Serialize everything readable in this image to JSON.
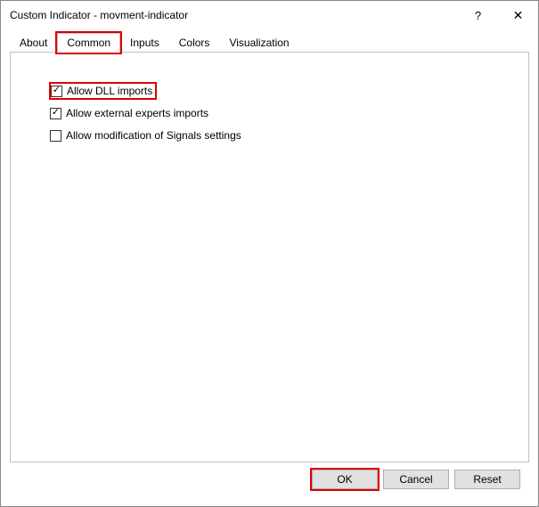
{
  "window": {
    "title": "Custom Indicator - movment-indicator",
    "help": "?",
    "close": "✕"
  },
  "tabs": {
    "about": "About",
    "common": "Common",
    "inputs": "Inputs",
    "colors": "Colors",
    "visualization": "Visualization"
  },
  "options": {
    "allow_dll": {
      "label": "Allow DLL imports",
      "checked": true
    },
    "allow_external": {
      "label": "Allow external experts imports",
      "checked": true
    },
    "allow_signals": {
      "label": "Allow modification of Signals settings",
      "checked": false
    }
  },
  "buttons": {
    "ok": "OK",
    "cancel": "Cancel",
    "reset": "Reset"
  }
}
